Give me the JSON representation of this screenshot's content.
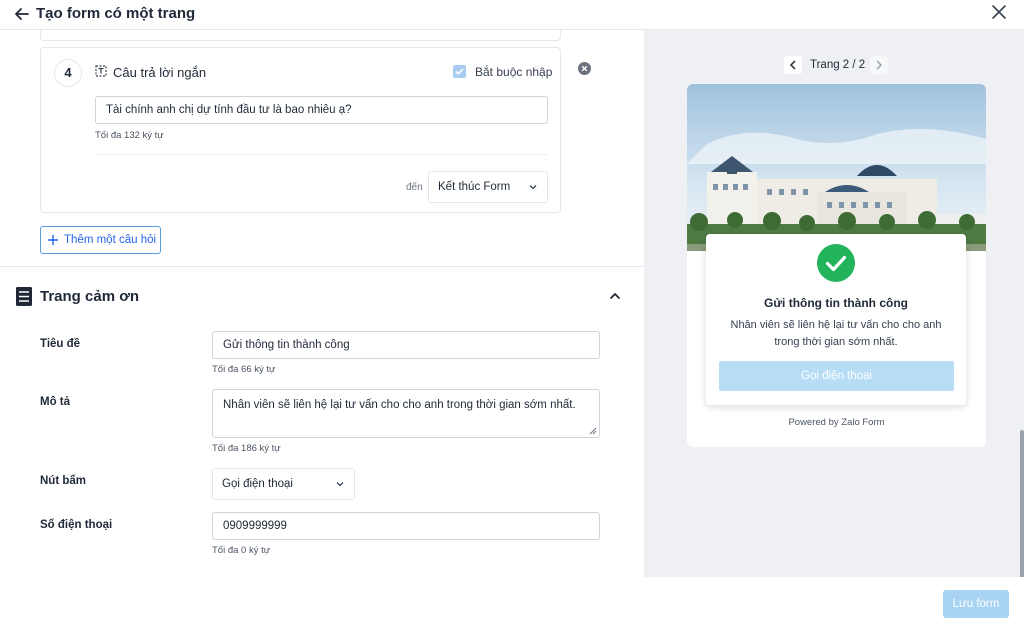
{
  "header": {
    "title": "Tạo form có một trang"
  },
  "question": {
    "number": "4",
    "type_label": "Câu trả lời ngắn",
    "required_label": "Bắt buộc nhập",
    "required_checked": true,
    "value": "Tài chính anh chị dự tính đầu tư là bao nhiêu ạ?",
    "hint": "Tối đa 132 ký tự",
    "goto_label": "đến",
    "goto_value": "Kết thúc Form"
  },
  "add_question_label": "Thêm một câu hỏi",
  "thank_you": {
    "section_title": "Trang cảm ơn",
    "title_label": "Tiêu đề",
    "title_value": "Gửi thông tin thành công",
    "title_hint": "Tối đa 66 ký tự",
    "desc_label": "Mô tả",
    "desc_value": "Nhân viên sẽ liên hệ lại tư vấn cho cho anh trong thời gian sớm nhất.",
    "desc_hint": "Tối đa 186 ký tự",
    "button_label": "Nút bấm",
    "button_value": "Gọi điện thoại",
    "phone_label": "Số điện thoại",
    "phone_value": "0909999999",
    "phone_hint": "Tối đa 0 ký tự"
  },
  "preview": {
    "pager": "Trang 2 / 2",
    "card_title": "Gửi thông tin thành công",
    "card_desc": "Nhân viên sẽ liên hệ lại tư vấn cho cho anh trong thời gian sớm nhất.",
    "card_button": "Gọi điện thoại",
    "powered_by": "Powered by Zalo Form"
  },
  "footer": {
    "save_label": "Lưu form"
  },
  "colors": {
    "accent": "#2563eb",
    "success": "#22b45a",
    "disabled_button": "#a8d3f3"
  }
}
